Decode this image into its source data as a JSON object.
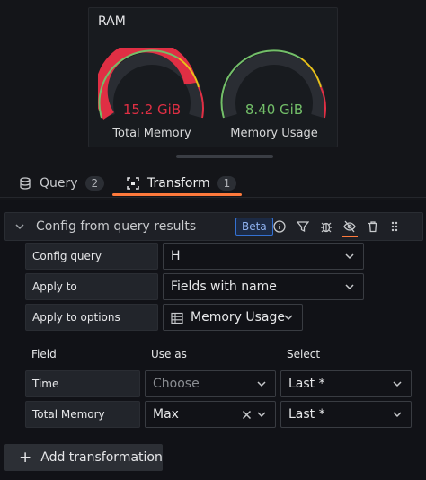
{
  "panel": {
    "title": "RAM",
    "gauges": [
      {
        "value": "15.2 GiB",
        "label": "Total Memory",
        "value_color": "#e02f44",
        "fill_fraction": 0.92
      },
      {
        "value": "8.40 GiB",
        "label": "Memory Usage",
        "value_color": "#73bf69",
        "fill_fraction": 0.0
      }
    ]
  },
  "tabs": [
    {
      "label": "Query",
      "count": "2",
      "icon": "database-icon"
    },
    {
      "label": "Transform",
      "count": "1",
      "icon": "transform-icon"
    }
  ],
  "transformation": {
    "title": "Config from query results",
    "badge": "Beta",
    "tools": [
      "info-icon",
      "filter-icon",
      "debug-icon",
      "eye-slash-icon",
      "trash-icon",
      "drag-icon"
    ]
  },
  "config": {
    "config_query_label": "Config query",
    "config_query_value": "H",
    "apply_to_label": "Apply to",
    "apply_to_value": "Fields with name",
    "apply_to_options_label": "Apply to options",
    "apply_to_options_value": "Memory Usage"
  },
  "mapping": {
    "headers": {
      "field": "Field",
      "use_as": "Use as",
      "select": "Select"
    },
    "rows": [
      {
        "field": "Time",
        "use_as": "",
        "use_as_placeholder": "Choose",
        "select": "Last *"
      },
      {
        "field": "Total Memory",
        "use_as": "Max",
        "select": "Last *"
      }
    ]
  },
  "add_button": "Add transformation",
  "colors": {
    "accent": "#ff7a3c",
    "red": "#e02f44",
    "green": "#73bf69",
    "yellow": "#fade2a"
  }
}
